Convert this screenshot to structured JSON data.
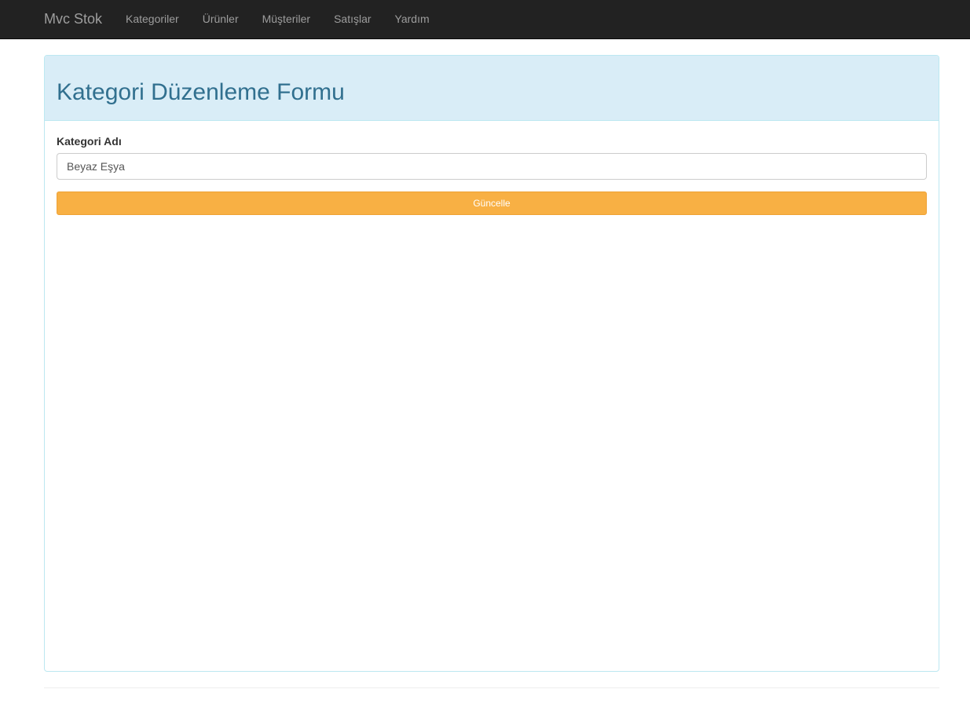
{
  "navbar": {
    "brand": "Mvc Stok",
    "items": [
      {
        "label": "Kategoriler"
      },
      {
        "label": "Ürünler"
      },
      {
        "label": "Müşteriler"
      },
      {
        "label": "Satışlar"
      },
      {
        "label": "Yardım"
      }
    ]
  },
  "panel": {
    "title": "Kategori Düzenleme Formu",
    "form": {
      "field_label": "Kategori Adı",
      "field_value": "Beyaz Eşya",
      "submit_label": "Güncelle"
    }
  },
  "colors": {
    "navbar_bg": "#222222",
    "panel_heading_bg": "#d9edf7",
    "title_color": "#31708f",
    "button_bg": "#f8b044"
  }
}
